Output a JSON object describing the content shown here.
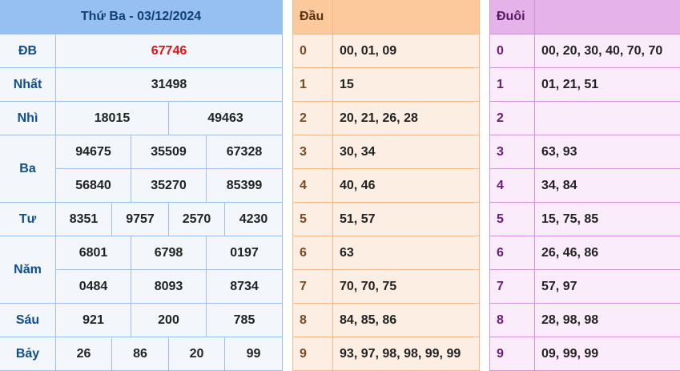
{
  "results": {
    "title": "Thứ Ba - 03/12/2024",
    "rows": [
      {
        "label": "ĐB",
        "numbers": [
          "67746"
        ]
      },
      {
        "label": "Nhất",
        "numbers": [
          "31498"
        ]
      },
      {
        "label": "Nhì",
        "numbers": [
          "18015",
          "49463"
        ]
      },
      {
        "label": "Ba",
        "numbers": [
          "94675",
          "35509",
          "67328",
          "56840",
          "35270",
          "85399"
        ]
      },
      {
        "label": "Tư",
        "numbers": [
          "8351",
          "9757",
          "2570",
          "4230"
        ]
      },
      {
        "label": "Năm",
        "numbers": [
          "6801",
          "6798",
          "0197",
          "0484",
          "8093",
          "8734"
        ]
      },
      {
        "label": "Sáu",
        "numbers": [
          "921",
          "200",
          "785"
        ]
      },
      {
        "label": "Bảy",
        "numbers": [
          "26",
          "86",
          "20",
          "99"
        ]
      }
    ]
  },
  "head": {
    "title": "Đầu",
    "rows": [
      {
        "digit": "0",
        "values": "00, 01, 09"
      },
      {
        "digit": "1",
        "values": "15"
      },
      {
        "digit": "2",
        "values": "20, 21, 26, 28"
      },
      {
        "digit": "3",
        "values": "30, 34"
      },
      {
        "digit": "4",
        "values": "40, 46"
      },
      {
        "digit": "5",
        "values": "51, 57"
      },
      {
        "digit": "6",
        "values": "63"
      },
      {
        "digit": "7",
        "values": "70, 70, 75"
      },
      {
        "digit": "8",
        "values": "84, 85, 86"
      },
      {
        "digit": "9",
        "values": "93, 97, 98, 98, 99, 99"
      }
    ]
  },
  "tail": {
    "title": "Đuôi",
    "rows": [
      {
        "digit": "0",
        "values": "00, 20, 30, 40, 70, 70"
      },
      {
        "digit": "1",
        "values": "01, 21, 51"
      },
      {
        "digit": "2",
        "values": ""
      },
      {
        "digit": "3",
        "values": "63, 93"
      },
      {
        "digit": "4",
        "values": "34, 84"
      },
      {
        "digit": "5",
        "values": "15, 75, 85"
      },
      {
        "digit": "6",
        "values": "26, 46, 86"
      },
      {
        "digit": "7",
        "values": "57, 97"
      },
      {
        "digit": "8",
        "values": "28, 98, 98"
      },
      {
        "digit": "9",
        "values": "09, 99, 99"
      }
    ]
  }
}
